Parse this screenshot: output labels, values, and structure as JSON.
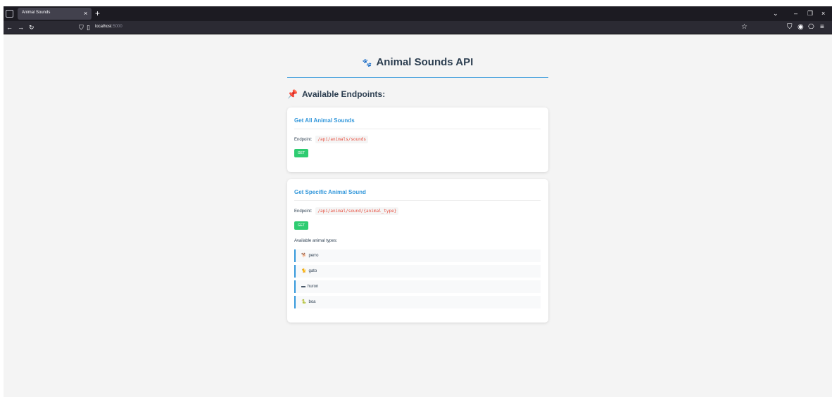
{
  "browser": {
    "tab_title": "Animal Sounds",
    "tab_close": "×",
    "new_tab": "+",
    "url_host": "localhost",
    "url_port": ":5000",
    "icons": [
      "tab-list-icon",
      "back-arrow-icon",
      "forward-arrow-icon",
      "reload-icon",
      "shield-icon",
      "page-icon",
      "star-icon",
      "pocket-icon",
      "account-icon",
      "extensions-icon",
      "menu-icon",
      "minimize-icon",
      "maximize-icon",
      "close-icon",
      "chevron-down-icon"
    ]
  },
  "page": {
    "title": "Animal Sounds API",
    "title_icon": "paw-icon",
    "section_title": "Available Endpoints:",
    "section_icon": "pushpin-icon",
    "endpoints": [
      {
        "title": "Get All Animal Sounds",
        "endpoint_label": "Endpoint:",
        "path": "/api/animals/sounds",
        "method": "GET"
      },
      {
        "title": "Get Specific Animal Sound",
        "endpoint_label": "Endpoint:",
        "path": "/api/animal/sound/{animal_type}",
        "method": "GET",
        "types_label": "Available animal types:",
        "types": [
          {
            "name": "perro",
            "icon": "dog-icon"
          },
          {
            "name": "gato",
            "icon": "cat-icon"
          },
          {
            "name": "huron",
            "icon": "ferret-icon"
          },
          {
            "name": "boa",
            "icon": "snake-icon"
          }
        ]
      }
    ]
  },
  "colors": {
    "accent": "#3498db",
    "heading": "#2c3e50",
    "method_bg": "#2ecc71",
    "path_text": "#e74c3c",
    "page_bg": "#f4f4f4"
  }
}
